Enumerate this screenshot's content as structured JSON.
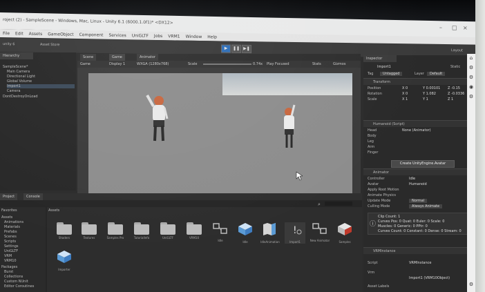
{
  "window": {
    "title": "roject (2) - SampleScene - Windows, Mac, Linux - Unity 6.1 (6000.1.0f1)* <DX12>",
    "controls": [
      "–",
      "□",
      "×"
    ]
  },
  "menu": [
    "File",
    "Edit",
    "Assets",
    "GameObject",
    "Component",
    "Services",
    "UniGLTF",
    "Jobs",
    "VRM1",
    "Window",
    "Help"
  ],
  "toolbar": {
    "account_label": "unity 6",
    "asset_store_label": "Asset Store",
    "layout_label": "Layout",
    "play_icon": "play-icon",
    "pause_icon": "pause-icon",
    "step_icon": "step-icon"
  },
  "hierarchy": {
    "tab": "Hierarchy",
    "items": [
      "SampleScene*",
      "Main Camera",
      "Directional Light",
      "Global Volume",
      "Import1",
      "Camera",
      "DontDestroyOnLoad"
    ]
  },
  "viewport": {
    "tabs": [
      "Scene",
      "Game",
      "Animator"
    ],
    "controls": [
      "Game",
      "Display 1",
      "WXGA (1280x768)",
      "Scale",
      "0.74x",
      "Play Focused"
    ],
    "right_controls": [
      "Stats",
      "Gizmos"
    ]
  },
  "inspector": {
    "tab": "Inspector",
    "object_name": "Import1",
    "tag_label": "Tag",
    "tag_value": "Untagged",
    "layer_label": "Layer",
    "layer_value": "Default",
    "static_label": "Static",
    "transform": {
      "title": "Transform",
      "rows": [
        {
          "label": "Position",
          "x": "X 0",
          "y": "Y 0.00101",
          "z": "Z -0.15"
        },
        {
          "label": "Rotation",
          "x": "X 0",
          "y": "Y 1.082",
          "z": "Z -0.0336"
        },
        {
          "label": "Scale",
          "x": "X 1",
          "y": "Y 1",
          "z": "Z 1"
        }
      ]
    },
    "humanoid": {
      "title": "Humanoid (Script)",
      "rows": [
        "Head",
        "Body",
        "Leg",
        "Arm",
        "Finger"
      ],
      "value": "None (Animator)",
      "button": "Create UnityEngine.Avatar"
    },
    "animator": {
      "title": "Animator",
      "rows": [
        {
          "label": "Controller",
          "value": "Idle"
        },
        {
          "label": "Avatar",
          "value": "Humanoid"
        },
        {
          "label": "Apply Root Motion",
          "value": ""
        },
        {
          "label": "Animate Physics",
          "value": ""
        },
        {
          "label": "Update Mode",
          "value": "Normal"
        },
        {
          "label": "Culling Mode",
          "value": "Always Animate"
        }
      ],
      "info_lines": [
        "Clip Count: 1",
        "Curves Pos: 0 Quat: 0 Euler: 0 Scale: 0",
        "Muscles: 0 Generic: 0 PPtr: 0",
        "Curves Count: 0 Constant: 0 Dense: 0 Stream: 0"
      ]
    },
    "vrm": {
      "title": "VRMInstance",
      "rows": [
        {
          "label": "Script",
          "value": "VRMInstance"
        },
        {
          "label": "Vrm",
          "value": "Import1 (VRM10Object)"
        }
      ],
      "footer": "Asset Labels"
    }
  },
  "project": {
    "tabs": [
      "Project",
      "Console"
    ],
    "search_placeholder": "",
    "tree": [
      "Favorites",
      "Assets",
      "Animations",
      "Materials",
      "Prefabs",
      "Scenes",
      "Scripts",
      "Settings",
      "UniGLTF",
      "VRM",
      "VRM10",
      "Packages",
      "Burst",
      "Collections",
      "Custom NUnit",
      "Editor Coroutines"
    ],
    "breadcrumb": "Assets",
    "assets": [
      {
        "label": "Shaders",
        "kind": "folder"
      },
      {
        "label": "Textures",
        "kind": "folder"
      },
      {
        "label": "Samples Pro",
        "kind": "folder"
      },
      {
        "label": "TutorialInfo",
        "kind": "folder"
      },
      {
        "label": "UniGLTF",
        "kind": "folder"
      },
      {
        "label": "VRM10",
        "kind": "folder"
      },
      {
        "label": "Idle",
        "kind": "animator"
      },
      {
        "label": "Idle",
        "kind": "prefab"
      },
      {
        "label": "IdleAnimation",
        "kind": "animation"
      },
      {
        "label": "Import1",
        "kind": "warning"
      },
      {
        "label": "New Animator",
        "kind": "animator"
      },
      {
        "label": "Samples",
        "kind": "prefab-red"
      },
      {
        "label": "Importer",
        "kind": "prefab"
      }
    ]
  },
  "colors": {
    "accent": "#2d6eb8",
    "panel": "#282828",
    "game_bg": "#8d8d8d"
  }
}
